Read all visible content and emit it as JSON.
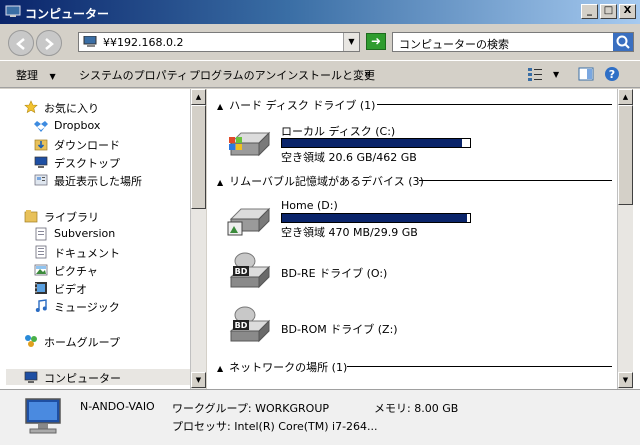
{
  "window": {
    "title": "コンピューター"
  },
  "window_buttons": {
    "minimize": "_",
    "maximize": "□",
    "close": "X"
  },
  "address_bar": {
    "value": "¥¥192.168.0.2",
    "search_placeholder": "コンピューターの検索"
  },
  "toolbar": {
    "organize": "整理",
    "system_properties": "システムのプロパティ",
    "uninstall": "プログラムのアンインストールと変更",
    "more": "»"
  },
  "nav_pane": {
    "items": [
      {
        "label": "お気に入り",
        "icon": "star-icon"
      },
      {
        "label": "Dropbox",
        "icon": "dropbox-icon"
      },
      {
        "label": "ダウンロード",
        "icon": "download-folder-icon"
      },
      {
        "label": "デスクトップ",
        "icon": "desktop-icon"
      },
      {
        "label": "最近表示した場所",
        "icon": "recent-places-icon"
      },
      {
        "label": "ライブラリ",
        "icon": "library-icon"
      },
      {
        "label": "Subversion",
        "icon": "document-icon"
      },
      {
        "label": "ドキュメント",
        "icon": "documents-icon"
      },
      {
        "label": "ピクチャ",
        "icon": "pictures-icon"
      },
      {
        "label": "ビデオ",
        "icon": "videos-icon"
      },
      {
        "label": "ミュージック",
        "icon": "music-icon"
      },
      {
        "label": "ホームグループ",
        "icon": "homegroup-icon"
      },
      {
        "label": "コンピューター",
        "icon": "computer-icon"
      }
    ]
  },
  "content": {
    "groups": [
      {
        "label": "ハード ディスク ドライブ (1)"
      },
      {
        "label": "リムーバブル記憶域があるデバイス (3)"
      },
      {
        "label": "ネットワークの場所 (1)"
      }
    ],
    "drives": [
      {
        "name": "ローカル ディスク (C:)",
        "free": "空き領域 20.6 GB/462 GB",
        "used_fraction": 0.955,
        "icon": "hard-disk-icon"
      },
      {
        "name": "Home (D:)",
        "free": "空き領域 470 MB/29.9 GB",
        "used_fraction": 0.985,
        "icon": "removable-drive-icon"
      },
      {
        "name": "BD-RE ドライブ (O:)",
        "icon": "bd-drive-icon"
      },
      {
        "name": "BD-ROM ドライブ (Z:)",
        "icon": "bd-drive-icon"
      }
    ]
  },
  "details": {
    "computer_name": "N-ANDO-VAIO",
    "workgroup": "ワークグループ: WORKGROUP",
    "memory": "メモリ: 8.00 GB",
    "processor": "プロセッサ: Intel(R) Core(TM) i7-264..."
  }
}
